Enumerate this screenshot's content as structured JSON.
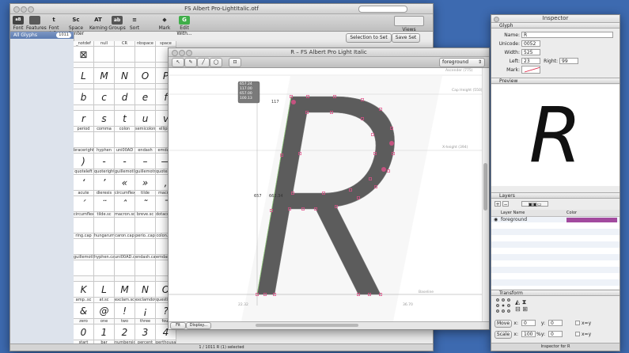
{
  "font_window": {
    "title": "FS Albert Pro-LightItalic.otf",
    "search_placeholder": "",
    "toolbar": [
      {
        "label": "Font",
        "icon": "aBYZ"
      },
      {
        "label": "Features",
        "icon": "▭"
      },
      {
        "label": "Font Info",
        "icon": "t"
      },
      {
        "label": "Space Center",
        "icon": "Sc"
      },
      {
        "label": "Kerning",
        "icon": "AT"
      },
      {
        "label": "Groups",
        "icon": "ab"
      },
      {
        "label": "Sort",
        "icon": "≡"
      },
      {
        "label": "Mark",
        "icon": "◆"
      },
      {
        "label": "Edit With...",
        "icon": "G"
      }
    ],
    "views_label": "Views",
    "sidebar": {
      "selected": "All Glyphs",
      "count": "1011"
    },
    "selection_button": "Selection to Set",
    "save_set_button": "Save Set",
    "status": "1 / 1011 R (1) selected",
    "header_names": [
      "_notdef",
      "null",
      "CR",
      "nbspace",
      "space"
    ],
    "rows": [
      {
        "chars": [
          "⊠",
          "",
          "",
          "",
          ""
        ],
        "names": [
          "",
          "",
          "",
          "",
          ""
        ]
      },
      {
        "chars": [
          "L",
          "M",
          "N",
          "O",
          "P"
        ],
        "names": [
          "",
          "",
          "",
          "",
          ""
        ]
      },
      {
        "chars": [
          "b",
          "c",
          "d",
          "e",
          "f"
        ],
        "names": [
          "",
          "",
          "",
          "",
          ""
        ]
      },
      {
        "chars": [
          "r",
          "s",
          "t",
          "u",
          "v"
        ],
        "names": [
          "period",
          "comma",
          "colon",
          "semicolon",
          "ellipsis"
        ]
      },
      {
        "chars": [
          "",
          "",
          "",
          "",
          ""
        ],
        "names": [
          "braceright",
          "hyphen",
          "uni00AD",
          "endash",
          "emdash"
        ]
      },
      {
        "chars": [
          ")",
          "-",
          "-",
          "–",
          "—"
        ],
        "names": [
          "quoteleft",
          "quoteright",
          "guillemotleft",
          "guillemotright",
          "quotesinglbase"
        ]
      },
      {
        "chars": [
          "‘",
          "’",
          "«",
          "»",
          "‚"
        ],
        "names": [
          "acute",
          "dieresis",
          "circumflex",
          "tilde",
          "macron"
        ]
      },
      {
        "chars": [
          "´",
          "¨",
          "ˆ",
          "˜",
          "¯"
        ],
        "names": [
          "circumflex.sc",
          "tilde.sc",
          "macron.sc",
          "breve.sc",
          "dotaccent.sc"
        ]
      },
      {
        "chars": [
          "",
          "",
          "",
          "",
          ""
        ],
        "names": [
          "ring.cap",
          "hungarumlaut.cap",
          "caron.cap",
          "perio..cap",
          "colon.cap"
        ]
      },
      {
        "chars": [
          "",
          "",
          "",
          "",
          ""
        ],
        "names": [
          "guillemotleft.cap",
          "hyphen.cap",
          "uni00AD.cap",
          "endash.cap",
          "emdash.cap"
        ]
      },
      {
        "chars": [
          "",
          "",
          "",
          "",
          ""
        ],
        "names": [
          "",
          "",
          "",
          "",
          ""
        ]
      },
      {
        "chars": [
          "K",
          "L",
          "M",
          "N",
          "O"
        ],
        "names": [
          "amp..sc",
          "at.sc",
          "exclam.sc",
          "exclamdown.sc",
          "question.sc"
        ]
      },
      {
        "chars": [
          "&",
          "@",
          "!",
          "¡",
          "?"
        ],
        "names": [
          "zero",
          "one",
          "two",
          "three",
          "four"
        ]
      },
      {
        "chars": [
          "0",
          "1",
          "2",
          "3",
          "4"
        ],
        "names": [
          "start",
          "bar",
          "numbersign",
          "percent",
          "perthousand"
        ]
      }
    ]
  },
  "glyph_window": {
    "title": "R – FS Albert Pro Light Italic",
    "layer_select": "foreground",
    "metrics_labels": {
      "ascender": "Ascender (775)",
      "capheight": "Cap Height (550)",
      "xheight": "X-height (394)",
      "baseline": "Baseline"
    },
    "info_box": [
      "657.24",
      "117.00",
      "657.00",
      "100.13"
    ],
    "measure_top": "117",
    "measure_left": "657",
    "measure_mid": "662.34",
    "bottom_left_value": "22.32",
    "bottom_right_value": "36.70",
    "footer_zoom": "Fit",
    "footer_display": "Display..."
  },
  "inspector": {
    "title": "Inspector",
    "glyph_section": "Glyph",
    "fields": {
      "name_label": "Name:",
      "name": "R",
      "unicode_label": "Unicode:",
      "unicode": "0052",
      "width_label": "Width:",
      "width": "525",
      "left_label": "Left:",
      "left": "23",
      "right_label": "Right:",
      "right": "99",
      "mark_label": "Mark:"
    },
    "preview_section": "Preview",
    "preview_char": "R",
    "layers_section": "Layers",
    "layer_col_name": "Layer Name",
    "layer_col_color": "Color",
    "layers": [
      {
        "name": "foreground",
        "color": "#a24a9e"
      }
    ],
    "transform_section": "Transform",
    "move_button": "Move",
    "move_x": "0",
    "move_y": "0",
    "scale_button": "Scale",
    "scale_x": "100",
    "scale_y": "0",
    "x_label": "x:",
    "y_label": "y:",
    "pct": "%",
    "xy_label": "x=y",
    "footer": "Inspector for R"
  },
  "colors": {
    "desktop": "#3d6ab0",
    "glyph_fill": "#5c5c5c",
    "point": "#e0508a",
    "layer_color": "#a24a9e"
  }
}
